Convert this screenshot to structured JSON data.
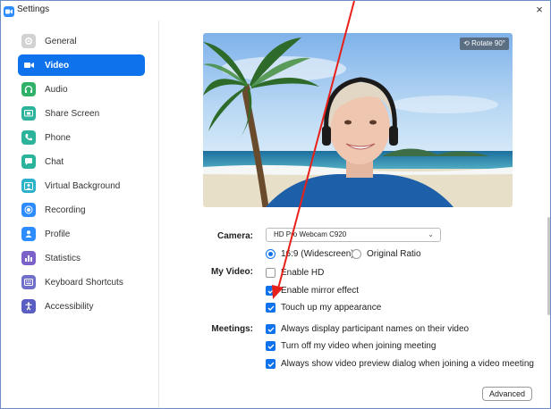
{
  "window": {
    "title": "Settings",
    "close_glyph": "×"
  },
  "colors": {
    "accent": "#0e72ed",
    "annotation_arrow": "#e8201a"
  },
  "sidebar": {
    "items": [
      {
        "label": "General",
        "icon": "gear-icon",
        "color": "#c9c9c9",
        "active": false
      },
      {
        "label": "Video",
        "icon": "video-camera-icon",
        "color": "#0e72ed",
        "active": true
      },
      {
        "label": "Audio",
        "icon": "headphones-icon",
        "color": "#30b16a",
        "active": false
      },
      {
        "label": "Share Screen",
        "icon": "share-screen-icon",
        "color": "#2cb39c",
        "active": false
      },
      {
        "label": "Phone",
        "icon": "phone-icon",
        "color": "#2cb39c",
        "active": false
      },
      {
        "label": "Chat",
        "icon": "chat-icon",
        "color": "#2cb39c",
        "active": false
      },
      {
        "label": "Virtual Background",
        "icon": "virtual-background-icon",
        "color": "#2cb3c9",
        "active": false
      },
      {
        "label": "Recording",
        "icon": "recording-icon",
        "color": "#2d8cff",
        "active": false
      },
      {
        "label": "Profile",
        "icon": "profile-icon",
        "color": "#2d8cff",
        "active": false
      },
      {
        "label": "Statistics",
        "icon": "statistics-icon",
        "color": "#7b61c8",
        "active": false
      },
      {
        "label": "Keyboard Shortcuts",
        "icon": "keyboard-icon",
        "color": "#6f6fc9",
        "active": false
      },
      {
        "label": "Accessibility",
        "icon": "accessibility-icon",
        "color": "#5a5ec2",
        "active": false
      }
    ]
  },
  "video": {
    "rotate_label": "Rotate 90°",
    "camera_label": "Camera:",
    "camera_value": "HD Pro Webcam C920",
    "aspect_options": [
      {
        "label": "16:9 (Widescreen)",
        "selected": true
      },
      {
        "label": "Original Ratio",
        "selected": false
      }
    ],
    "my_video_label": "My Video:",
    "my_video_options": [
      {
        "label": "Enable HD",
        "checked": false
      },
      {
        "label": "Enable mirror effect",
        "checked": true
      },
      {
        "label": "Touch up my appearance",
        "checked": true
      }
    ],
    "meetings_label": "Meetings:",
    "meetings_options": [
      {
        "label": "Always display participant names on their video",
        "checked": true
      },
      {
        "label": "Turn off my video when joining meeting",
        "checked": true
      },
      {
        "label": "Always show video preview dialog when joining a video meeting",
        "checked": true
      }
    ],
    "advanced_label": "Advanced"
  }
}
